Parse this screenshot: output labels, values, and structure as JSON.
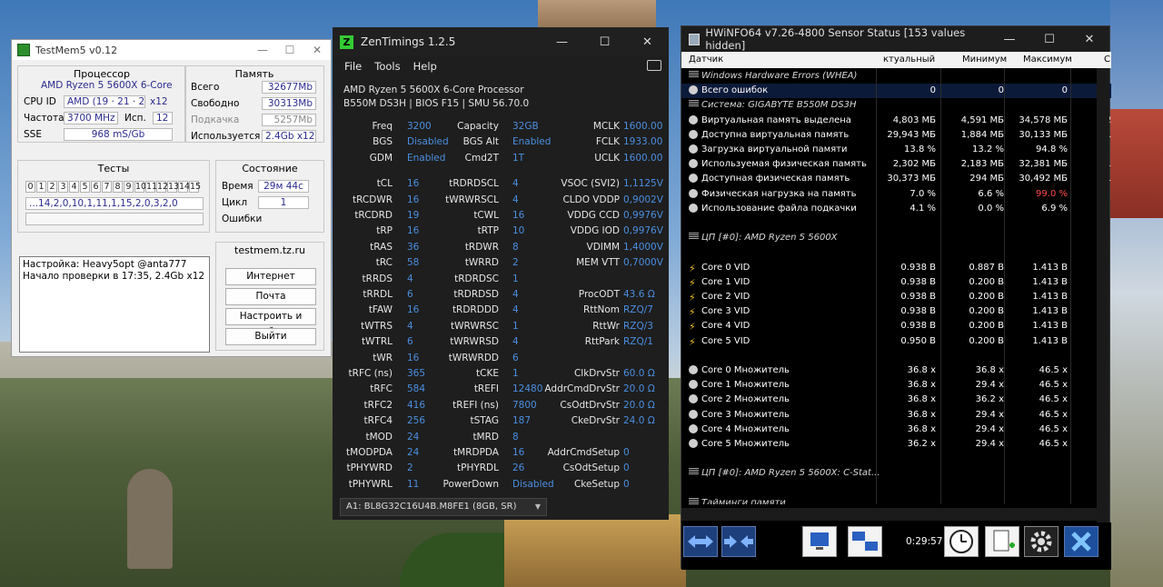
{
  "testmem5": {
    "title": "TestMem5 v0.12",
    "processor": {
      "heading": "Процессор",
      "name": "AMD Ryzen 5 5600X 6-Core",
      "cpuid_label": "CPU ID",
      "cpuid": "AMD (19 · 21 · 2)",
      "cpuid_x": "x12",
      "freq_label": "Частота",
      "freq": "3700 MHz",
      "used_label": "Исп.",
      "used": "12",
      "sse_label": "SSE",
      "sse": "968 mS/Gb"
    },
    "memory": {
      "heading": "Память",
      "total_label": "Всего",
      "total": "32677Mb",
      "free_label": "Свободно",
      "free": "30313Mb",
      "swap_label": "Подкачка",
      "swap": "5257Mb",
      "usage_label": "Используется",
      "usage": "2.4Gb x12"
    },
    "tests": {
      "heading": "Тесты",
      "numbers": [
        "0",
        "1",
        "2",
        "3",
        "4",
        "5",
        "6",
        "7",
        "8",
        "9",
        "10",
        "11",
        "12",
        "13",
        "14",
        "15"
      ],
      "sequence": "...14,2,0,10,1,11,1,15,2,0,3,2,0"
    },
    "state": {
      "heading": "Состояние",
      "time_label": "Время",
      "time": "29м 44с",
      "cycle_label": "Цикл",
      "cycle": "1",
      "errors_label": "Ошибки",
      "errors": ""
    },
    "log": {
      "line1": "Настройка: Heavy5opt @anta777",
      "line2": "Начало проверки в 17:35, 2.4Gb x12"
    },
    "site": {
      "heading": "testmem.tz.ru",
      "btn_internet": "Интернет",
      "btn_mail": "Почта",
      "btn_setup": "Настроить и выйти",
      "btn_exit": "Выйти"
    }
  },
  "zentimings": {
    "title": "ZenTimings 1.2.5",
    "menu": [
      "File",
      "Tools",
      "Help"
    ],
    "cpu": "AMD Ryzen 5 5600X 6-Core Processor",
    "board": "B550M DS3H | BIOS F15 | SMU 56.70.0",
    "col1": [
      [
        "Freq",
        "3200"
      ],
      [
        "BGS",
        "Disabled"
      ],
      [
        "GDM",
        "Enabled"
      ],
      [
        "tCL",
        "16"
      ],
      [
        "tRCDWR",
        "16"
      ],
      [
        "tRCDRD",
        "19"
      ],
      [
        "tRP",
        "16"
      ],
      [
        "tRAS",
        "36"
      ],
      [
        "tRC",
        "58"
      ],
      [
        "tRRDS",
        "4"
      ],
      [
        "tRRDL",
        "6"
      ],
      [
        "tFAW",
        "16"
      ],
      [
        "tWTRS",
        "4"
      ],
      [
        "tWTRL",
        "6"
      ],
      [
        "tWR",
        "16"
      ],
      [
        "tRFC (ns)",
        "365"
      ],
      [
        "tRFC",
        "584"
      ],
      [
        "tRFC2",
        "416"
      ],
      [
        "tRFC4",
        "256"
      ],
      [
        "tMOD",
        "24"
      ],
      [
        "tMODPDA",
        "24"
      ],
      [
        "tPHYWRD",
        "2"
      ],
      [
        "tPHYWRL",
        "11"
      ]
    ],
    "col2": [
      [
        "Capacity",
        "32GB"
      ],
      [
        "BGS Alt",
        "Enabled"
      ],
      [
        "Cmd2T",
        "1T"
      ],
      [
        "tRDRDSCL",
        "4"
      ],
      [
        "tWRWRSCL",
        "4"
      ],
      [
        "tCWL",
        "16"
      ],
      [
        "tRTP",
        "10"
      ],
      [
        "tRDWR",
        "8"
      ],
      [
        "tWRRD",
        "2"
      ],
      [
        "tRDRDSC",
        "1"
      ],
      [
        "tRDRDSD",
        "4"
      ],
      [
        "tRDRDDD",
        "4"
      ],
      [
        "tWRWRSC",
        "1"
      ],
      [
        "tWRWRSD",
        "4"
      ],
      [
        "tWRWRDD",
        "6"
      ],
      [
        "tCKE",
        "1"
      ],
      [
        "tREFI",
        "12480"
      ],
      [
        "tREFI (ns)",
        "7800"
      ],
      [
        "tSTAG",
        "187"
      ],
      [
        "tMRD",
        "8"
      ],
      [
        "tMRDPDA",
        "16"
      ],
      [
        "tPHYRDL",
        "26"
      ],
      [
        "PowerDown",
        "Disabled"
      ]
    ],
    "col3": [
      [
        "MCLK",
        "1600.00"
      ],
      [
        "FCLK",
        "1933.00"
      ],
      [
        "UCLK",
        "1600.00"
      ],
      [
        "VSOC (SVI2)",
        "1,1125V"
      ],
      [
        "CLDO VDDP",
        "0,9002V"
      ],
      [
        "VDDG CCD",
        "0,9976V"
      ],
      [
        "VDDG IOD",
        "0,9976V"
      ],
      [
        "VDIMM",
        "1,4000V"
      ],
      [
        "MEM VTT",
        "0,7000V"
      ],
      [
        "",
        ""
      ],
      [
        "ProcODT",
        "43.6 Ω"
      ],
      [
        "RttNom",
        "RZQ/7"
      ],
      [
        "RttWr",
        "RZQ/3"
      ],
      [
        "RttPark",
        "RZQ/1"
      ],
      [
        "",
        ""
      ],
      [
        "ClkDrvStr",
        "60.0 Ω"
      ],
      [
        "AddrCmdDrvStr",
        "20.0 Ω"
      ],
      [
        "CsOdtDrvStr",
        "20.0 Ω"
      ],
      [
        "CkeDrvStr",
        "24.0 Ω"
      ],
      [
        "",
        ""
      ],
      [
        "AddrCmdSetup",
        "0"
      ],
      [
        "CsOdtSetup",
        "0"
      ],
      [
        "CkeSetup",
        "0"
      ]
    ],
    "dimm": "A1: BL8G32C16U4B.M8FE1 (8GB, SR)"
  },
  "hwinfo": {
    "title": "HWiNFO64 v7.26-4800 Sensor Status [153 values hidden]",
    "headers": {
      "name": "Датчик",
      "current": "ктуальный",
      "min": "Минимум",
      "max": "Максимум",
      "avg": "С"
    },
    "rows": [
      {
        "type": "sec",
        "name": "Windows Hardware Errors (WHEA)"
      },
      {
        "type": "val",
        "icon": "circle",
        "name": "Всего ошибок",
        "c1": "0",
        "c2": "0",
        "c3": "0",
        "c4": "",
        "sel": true
      },
      {
        "type": "sec",
        "name": "Система: GIGABYTE B550M DS3H"
      },
      {
        "type": "val",
        "icon": "circle",
        "name": "Виртуальная память выделена",
        "c1": "4,803 МБ",
        "c2": "4,591 МБ",
        "c3": "34,578 МБ",
        "c4": "20"
      },
      {
        "type": "val",
        "icon": "circle",
        "name": "Доступна виртуальная память",
        "c1": "29,943 МБ",
        "c2": "1,884 МБ",
        "c3": "30,133 МБ",
        "c4": "15"
      },
      {
        "type": "val",
        "icon": "circle",
        "name": "Загрузка виртуальной памяти",
        "c1": "13.8 %",
        "c2": "13.2 %",
        "c3": "94.8 %",
        "c4": ""
      },
      {
        "type": "val",
        "icon": "circle",
        "name": "Используемая физическая память",
        "c1": "2,302 МБ",
        "c2": "2,183 МБ",
        "c3": "32,381 МБ",
        "c4": "17"
      },
      {
        "type": "val",
        "icon": "circle",
        "name": "Доступная физическая память",
        "c1": "30,373 МБ",
        "c2": "294 МБ",
        "c3": "30,492 МБ",
        "c4": "15"
      },
      {
        "type": "val",
        "icon": "circle",
        "name": "Физическая нагрузка на память",
        "c1": "7.0 %",
        "c2": "6.6 %",
        "c3": "99.0 %",
        "c4": "",
        "red3": true
      },
      {
        "type": "val",
        "icon": "circle",
        "name": "Использование файла подкачки",
        "c1": "4.1 %",
        "c2": "0.0 %",
        "c3": "6.9 %",
        "c4": ""
      },
      {
        "type": "blank"
      },
      {
        "type": "sec",
        "name": "ЦП [#0]: AMD Ryzen 5 5600X"
      },
      {
        "type": "blank"
      },
      {
        "type": "val",
        "icon": "bolt",
        "name": "Core 0 VID",
        "c1": "0.938 В",
        "c2": "0.887 В",
        "c3": "1.413 В",
        "c4": ""
      },
      {
        "type": "val",
        "icon": "bolt",
        "name": "Core 1 VID",
        "c1": "0.938 В",
        "c2": "0.200 В",
        "c3": "1.413 В",
        "c4": ""
      },
      {
        "type": "val",
        "icon": "bolt",
        "name": "Core 2 VID",
        "c1": "0.938 В",
        "c2": "0.200 В",
        "c3": "1.413 В",
        "c4": ""
      },
      {
        "type": "val",
        "icon": "bolt",
        "name": "Core 3 VID",
        "c1": "0.938 В",
        "c2": "0.200 В",
        "c3": "1.413 В",
        "c4": ""
      },
      {
        "type": "val",
        "icon": "bolt",
        "name": "Core 4 VID",
        "c1": "0.938 В",
        "c2": "0.200 В",
        "c3": "1.413 В",
        "c4": ""
      },
      {
        "type": "val",
        "icon": "bolt",
        "name": "Core 5 VID",
        "c1": "0.950 В",
        "c2": "0.200 В",
        "c3": "1.413 В",
        "c4": ""
      },
      {
        "type": "blank"
      },
      {
        "type": "val",
        "icon": "circle",
        "name": "Core 0 Множитель",
        "c1": "36.8 x",
        "c2": "36.8 x",
        "c3": "46.5 x",
        "c4": ""
      },
      {
        "type": "val",
        "icon": "circle",
        "name": "Core 1 Множитель",
        "c1": "36.8 x",
        "c2": "29.4 x",
        "c3": "46.5 x",
        "c4": ""
      },
      {
        "type": "val",
        "icon": "circle",
        "name": "Core 2 Множитель",
        "c1": "36.8 x",
        "c2": "36.2 x",
        "c3": "46.5 x",
        "c4": ""
      },
      {
        "type": "val",
        "icon": "circle",
        "name": "Core 3 Множитель",
        "c1": "36.8 x",
        "c2": "29.4 x",
        "c3": "46.5 x",
        "c4": ""
      },
      {
        "type": "val",
        "icon": "circle",
        "name": "Core 4 Множитель",
        "c1": "36.8 x",
        "c2": "29.4 x",
        "c3": "46.5 x",
        "c4": ""
      },
      {
        "type": "val",
        "icon": "circle",
        "name": "Core 5 Множитель",
        "c1": "36.2 x",
        "c2": "29.4 x",
        "c3": "46.5 x",
        "c4": ""
      },
      {
        "type": "blank"
      },
      {
        "type": "sec",
        "name": "ЦП [#0]: AMD Ryzen 5 5600X: C-Stat..."
      },
      {
        "type": "blank"
      },
      {
        "type": "sec",
        "name": "Тайминги памяти"
      }
    ],
    "timer": "0:29:57",
    "buttons": [
      "arrows-expand-icon",
      "arrows-collapse-icon",
      "monitor-icon",
      "network-icon",
      "clock-icon",
      "report-add-icon",
      "gear-icon",
      "close-icon"
    ]
  },
  "colors": {
    "zen_value": "#4b8fe0",
    "hw_red": "#ff4a4a",
    "tm5_value": "#2b2b8f"
  }
}
